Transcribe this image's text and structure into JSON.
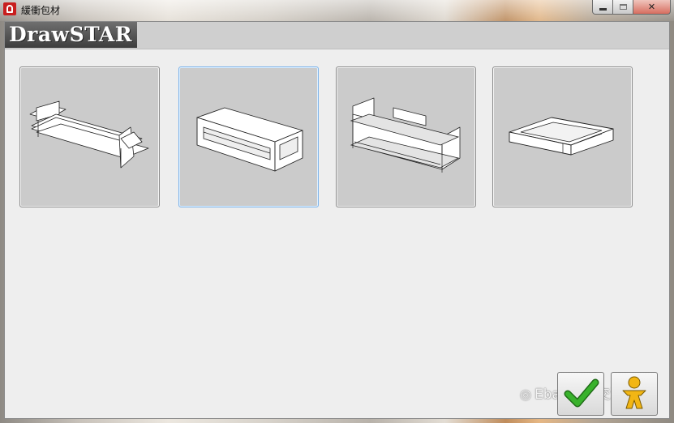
{
  "window": {
    "title": "緩衝包材",
    "app_icon": "drawstar-app-icon",
    "minimize_icon": "minimize-icon",
    "maximize_icon": "maximize-icon",
    "close_label": "✕"
  },
  "header": {
    "logo_text": "DrawSTAR"
  },
  "templates": [
    {
      "name": "end-cap-shelf-template",
      "icon": "end-cap-shelf-icon",
      "selected": false
    },
    {
      "name": "sleeve-tube-template",
      "icon": "sleeve-tube-icon",
      "selected": true
    },
    {
      "name": "double-shelf-template",
      "icon": "double-shelf-icon",
      "selected": false
    },
    {
      "name": "tray-template",
      "icon": "tray-icon",
      "selected": false
    }
  ],
  "watermark": {
    "text": "Ebay卖家交流"
  },
  "actions": {
    "ok_icon": "checkmark-icon",
    "ok_color": "#2e9a24",
    "user_icon": "person-icon",
    "user_color": "#f2b614"
  },
  "colors": {
    "tile_bg": "#cbcbcb",
    "selected_border": "#7eb4ea"
  }
}
